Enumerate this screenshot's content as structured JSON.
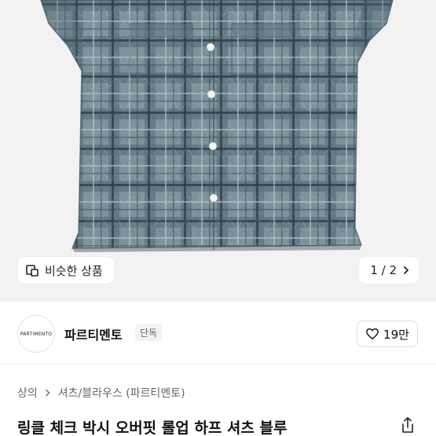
{
  "hero": {
    "similar_label": "비슷한 상품",
    "similar_icon": "similar-items-icon",
    "page_indicator": "1 / 2",
    "next_icon": "chevron-right-icon"
  },
  "brand": {
    "logo_text": "PARTIMENTO",
    "name": "파르티멘토",
    "badge": "단독",
    "like_count": "19만",
    "like_icon": "heart-outline-icon"
  },
  "breadcrumb": {
    "items": [
      "상의",
      "셔츠/블라우스 (파르티멘토)"
    ]
  },
  "product": {
    "title": "링클 체크 박시 오버핏 롤업 하프 셔츠 블루",
    "share_icon": "share-icon"
  },
  "colors": {
    "hero_bg": "#f2f2f2",
    "shirt_base": "#6f8791",
    "shirt_dark": "#3b4d57",
    "text_primary": "#111111",
    "text_secondary": "#666666"
  }
}
